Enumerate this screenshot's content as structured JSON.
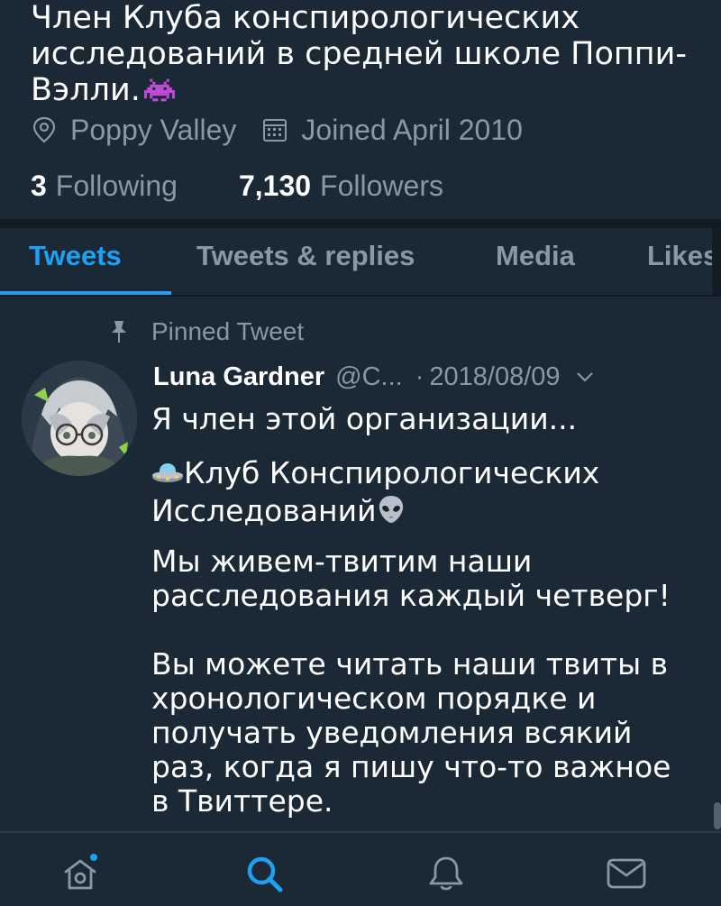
{
  "profile": {
    "bio": "Член Клуба конспирологических исследований в средней школе Поппи-Вэлли.",
    "bio_emoji_icon": "space-invader-icon",
    "location": "Poppy Valley",
    "joined": "Joined April 2010",
    "following_count": "3",
    "following_label": "Following",
    "followers_count": "7,130",
    "followers_label": "Followers"
  },
  "tabs": [
    {
      "label": "Tweets",
      "active": true
    },
    {
      "label": "Tweets & replies",
      "active": false
    },
    {
      "label": "Media",
      "active": false
    },
    {
      "label": "Likes",
      "active": false
    }
  ],
  "tweet": {
    "pinned_label": "Pinned Tweet",
    "author_name": "Luna Gardner",
    "author_handle": "@C...",
    "date": "2018/08/09",
    "paragraphs": {
      "p1": "Я член этой организации...",
      "p2_emoji_left": "flying-saucer-icon",
      "p2": "Клуб Конспирологических Исследований",
      "p2_emoji_right": "alien-icon",
      "p3": "Мы живем-твитим наши расследования каждый четверг!",
      "p4": "Вы можете читать наши твиты в хронологическом порядке и получать уведомления всякий раз, когда я пишу что-то важное в Твиттере."
    }
  },
  "colors": {
    "background": "#1b2836",
    "accent": "#1da1f2",
    "muted": "#8899a6"
  },
  "bottom_nav": [
    {
      "icon": "home-icon",
      "has_dot": true
    },
    {
      "icon": "search-icon",
      "active": true
    },
    {
      "icon": "bell-icon"
    },
    {
      "icon": "mail-icon"
    }
  ]
}
